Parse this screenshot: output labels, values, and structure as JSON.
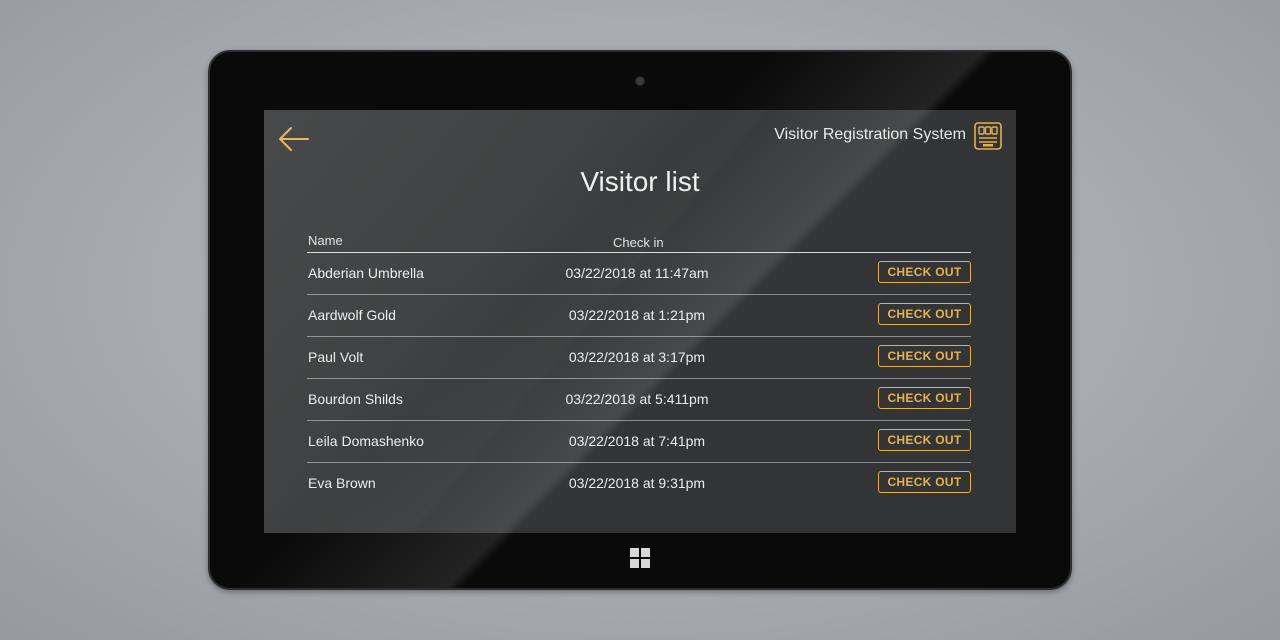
{
  "app": {
    "title": "Visitor Registration System",
    "accent_color": "#e3b04b",
    "back_icon": "arrow-left-icon",
    "app_icon": "registration-panel-icon"
  },
  "page": {
    "title": "Visitor list"
  },
  "table": {
    "columns": [
      "Name",
      "Check in"
    ],
    "rows": [
      {
        "name": "Abderian Umbrella",
        "check_in": "03/22/2018 at 11:47am",
        "action": "CHECK OUT"
      },
      {
        "name": "Aardwolf Gold",
        "check_in": "03/22/2018 at 1:21pm",
        "action": "CHECK OUT"
      },
      {
        "name": "Paul Volt",
        "check_in": "03/22/2018 at 3:17pm",
        "action": "CHECK OUT"
      },
      {
        "name": "Bourdon Shilds",
        "check_in": "03/22/2018 at 5:411pm",
        "action": "CHECK OUT"
      },
      {
        "name": "Leila Domashenko",
        "check_in": "03/22/2018 at 7:41pm",
        "action": "CHECK OUT"
      },
      {
        "name": "Eva Brown",
        "check_in": "03/22/2018 at 9:31pm",
        "action": "CHECK OUT"
      }
    ]
  },
  "device": {
    "home_icon": "windows-logo-icon",
    "camera_icon": "camera-icon"
  }
}
